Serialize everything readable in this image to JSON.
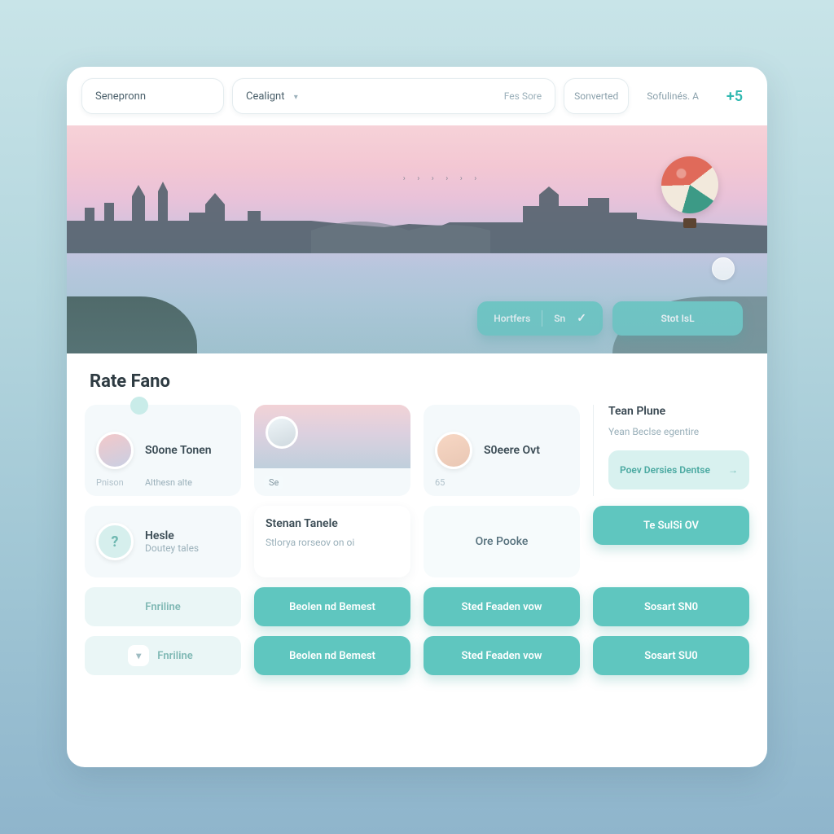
{
  "topbar": {
    "search_placeholder": "Senepronn",
    "category_label": "Cealignt",
    "category_hint": "Fes Sore",
    "sort_label": "Sonverted",
    "settings_label": "Sofulinés.  A",
    "more_label": "+5"
  },
  "hero": {
    "left_button_a": "Hortfers",
    "left_button_b": "Sn",
    "right_button": "Stot IsL",
    "indicator_icon": "heart-icon"
  },
  "section": {
    "title": "Rate Fano"
  },
  "sidebar": {
    "title": "Tean Plune",
    "subtitle": "Yean Beclse egentire",
    "chip_label": "Poev Dersies Dentse"
  },
  "tiles": {
    "r1c1": {
      "title": "S0one Tonen",
      "foot_left": "Pnison",
      "foot_right": "Althesn alte"
    },
    "r1c2": {
      "caption": "Se"
    },
    "r1c3": {
      "title": "S0eere Ovt",
      "value": "65"
    },
    "r2c1": {
      "title": "Hesle",
      "sub": "Doutey tales"
    },
    "r2c2": {
      "title": "Stenan Tanele",
      "sub": "Stlorya rorseov on oi"
    },
    "r2c3": {
      "title": "Ore Pooke"
    },
    "r2c4": {
      "label": "Te SulSi OV"
    },
    "r3c1": {
      "label": "Fnriline"
    },
    "r3c2": {
      "label": "Beolen nd Bemest"
    },
    "r3c3": {
      "label": "Sted Feaden vow"
    },
    "r3c4": {
      "label": "Sosart SN0"
    },
    "r4c1": {
      "label": "Fnriline"
    },
    "r4c2": {
      "label": "Beolen nd Bemest"
    },
    "r4c3": {
      "label": "Sted Feaden vow"
    },
    "r4c4": {
      "label": "Sosart SU0"
    }
  },
  "colors": {
    "accent": "#5fc6bf",
    "accent_soft": "#d8f1ef",
    "text": "#2e3b42",
    "muted": "#9ab0ba"
  }
}
